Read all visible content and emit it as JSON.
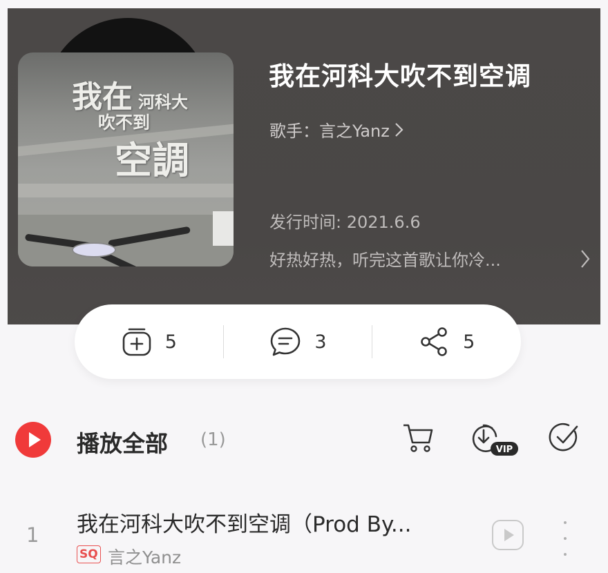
{
  "album": {
    "cover_text": {
      "line1": "我在",
      "line2": "河科大",
      "line3": "吹不到",
      "line4": "空調"
    }
  },
  "song": {
    "title": "我在河科大吹不到空调",
    "artist_line": "歌手：言之Yanz",
    "release": "发行时间: 2021.6.6",
    "description": "好热好热，听完这首歌让你冷..."
  },
  "actions": [
    {
      "icon": "add-playlist-icon",
      "count": "5"
    },
    {
      "icon": "comment-icon",
      "count": "3"
    },
    {
      "icon": "share-icon",
      "count": "5"
    }
  ],
  "play_all": {
    "label": "播放全部",
    "count": "(1)",
    "vip_badge": "VIP"
  },
  "tracks": [
    {
      "index": "1",
      "title": "我在河科大吹不到空调（Prod By...",
      "quality": "SQ",
      "artist": "言之Yanz"
    }
  ],
  "colors": {
    "header_bg": "#4b4847",
    "accent_red": "#f03a3a",
    "page_bg": "#f7f6f8"
  }
}
